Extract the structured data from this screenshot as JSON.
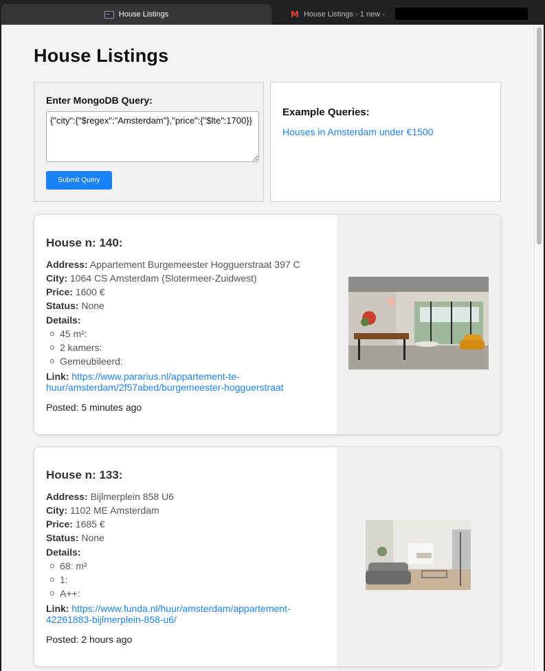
{
  "browser": {
    "tabs": [
      {
        "title": "House Listings",
        "icon": "terminal-icon"
      },
      {
        "title": "House Listings - 1 new -",
        "icon": "gmail-icon"
      }
    ]
  },
  "page": {
    "title": "House Listings"
  },
  "query": {
    "label": "Enter MongoDB Query:",
    "value": "{\"city\":{\"$regex\":\"Amsterdam\"},\"price\":{\"$lte\":1700}}",
    "submit_label": "Submit Query"
  },
  "examples": {
    "title": "Example Queries:",
    "items": [
      "Houses in Amsterdam under €1500"
    ]
  },
  "labels": {
    "address": "Address:",
    "city": "City:",
    "price": "Price:",
    "status": "Status:",
    "details": "Details:",
    "link": "Link:"
  },
  "listings": [
    {
      "title": "House n: 140:",
      "address": "Appartement Burgemeester Hogguerstraat 397 C",
      "city": "1064 CS Amsterdam (Slotermeer-Zuidwest)",
      "price": "1600 €",
      "status": "None",
      "details": [
        "45 m²:",
        "2 kamers:",
        "Gemeubileerd:"
      ],
      "link": "https://www.pararius.nl/appartement-te-huur/amsterdam/2f57abed/burgemeester-hogguerstraat",
      "posted": "Posted: 5 minutes ago"
    },
    {
      "title": "House n: 133:",
      "address": "Bijlmerplein 858 U6",
      "city": "1102 ME Amsterdam",
      "price": "1685 €",
      "status": "None",
      "details": [
        "68: m²",
        "1:",
        "A++:"
      ],
      "link": "https://www.funda.nl/huur/amsterdam/appartement-42261883-bijlmerplein-858-u6/",
      "posted": "Posted: 2 hours ago"
    }
  ],
  "colors": {
    "accent": "#1a82f7",
    "page_background": "#f4f4f4",
    "card_image_panel": "#f0f0f0"
  }
}
